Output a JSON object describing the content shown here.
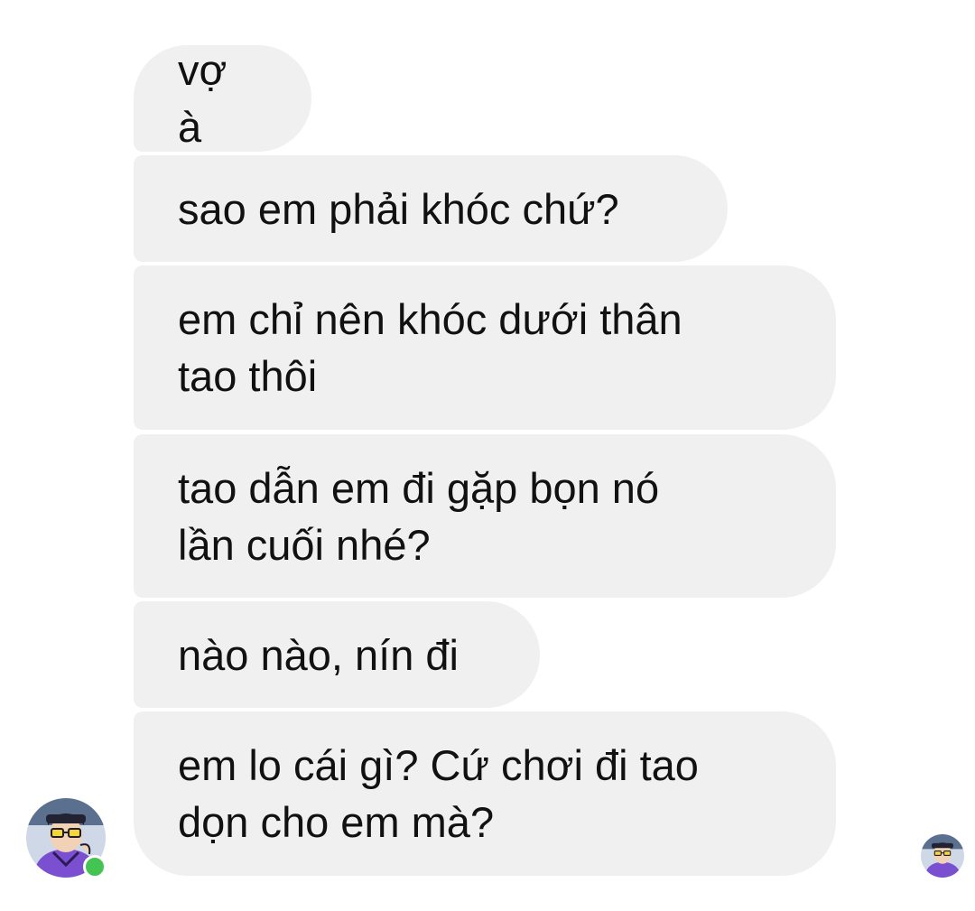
{
  "chat": {
    "messages": [
      {
        "text": "vợ à"
      },
      {
        "text": "sao em phải khóc chứ?"
      },
      {
        "text": "em chỉ nên khóc dưới thân\ntao thôi"
      },
      {
        "text": "tao dẫn em đi gặp bọn nó\nlần cuối nhé?"
      },
      {
        "text": "nào nào, nín đi"
      },
      {
        "text": "em lo cái gì? Cứ chơi đi tao\ndọn cho em mà?"
      }
    ],
    "sender_avatar": {
      "icon": "avatar-cartoon-man-purple-shirt"
    },
    "read_receipt": {
      "icon": "avatar-cartoon-man-purple-shirt"
    },
    "colors": {
      "bubble_background": "#f0f0f0",
      "text": "#111111",
      "online_indicator": "#44c553",
      "avatar_shirt": "#7a4fd0"
    }
  }
}
